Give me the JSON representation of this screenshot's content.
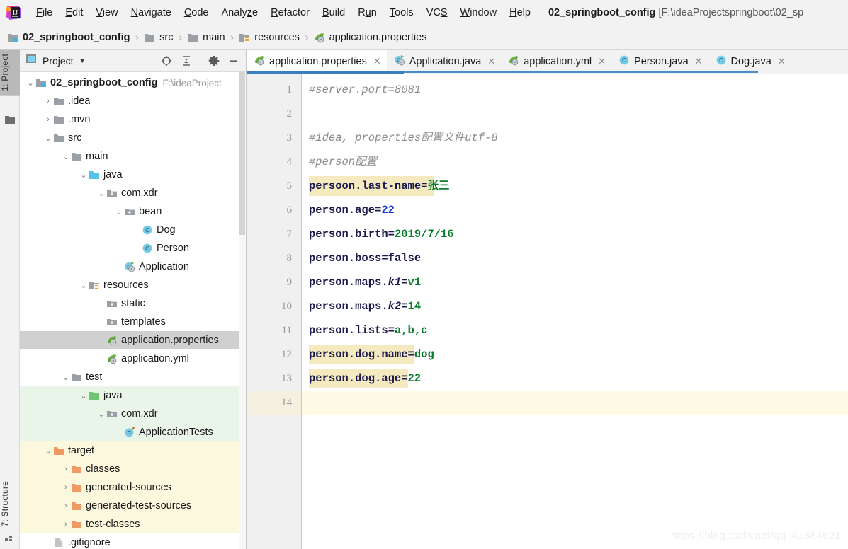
{
  "window": {
    "title_bold": "02_springboot_config",
    "title_path": "[F:\\ideaProjectspringboot\\02_sp"
  },
  "menubar": {
    "logo_icon": "intellij-idea-logo",
    "items": [
      {
        "label": "File",
        "mnemonic": "F"
      },
      {
        "label": "Edit",
        "mnemonic": "E"
      },
      {
        "label": "View",
        "mnemonic": "V"
      },
      {
        "label": "Navigate",
        "mnemonic": "N"
      },
      {
        "label": "Code",
        "mnemonic": "C"
      },
      {
        "label": "Analyze",
        "mnemonic": "z"
      },
      {
        "label": "Refactor",
        "mnemonic": "R"
      },
      {
        "label": "Build",
        "mnemonic": "B"
      },
      {
        "label": "Run",
        "mnemonic": "u"
      },
      {
        "label": "Tools",
        "mnemonic": "T"
      },
      {
        "label": "VCS",
        "mnemonic": "S"
      },
      {
        "label": "Window",
        "mnemonic": "W"
      },
      {
        "label": "Help",
        "mnemonic": "H"
      }
    ]
  },
  "breadcrumb": {
    "items": [
      {
        "label": "02_springboot_config",
        "icon": "module-folder-icon"
      },
      {
        "label": "src",
        "icon": "folder-icon"
      },
      {
        "label": "main",
        "icon": "folder-icon"
      },
      {
        "label": "resources",
        "icon": "resources-folder-icon"
      },
      {
        "label": "application.properties",
        "icon": "spring-properties-icon"
      }
    ],
    "separator": "›"
  },
  "toolstrip": {
    "project_tab": "1: Project",
    "structure_tab": "7: Structure"
  },
  "project_panel": {
    "title": "Project",
    "dropdown_icon": "chevron-down-icon",
    "tools": [
      {
        "name": "locate-icon"
      },
      {
        "name": "collapse-all-icon"
      },
      {
        "name": "gear-icon"
      },
      {
        "name": "minimize-icon"
      }
    ],
    "tree": [
      {
        "label": "02_springboot_config",
        "subpath": "F:\\ideaProject",
        "depth": 0,
        "arrow": "⌄",
        "icon": "module-folder-icon",
        "bold": true,
        "state": "none"
      },
      {
        "label": ".idea",
        "depth": 1,
        "arrow": "›",
        "icon": "folder-icon",
        "state": "none"
      },
      {
        "label": ".mvn",
        "depth": 1,
        "arrow": "›",
        "icon": "folder-icon",
        "state": "none"
      },
      {
        "label": "src",
        "depth": 1,
        "arrow": "⌄",
        "icon": "folder-icon",
        "state": "none"
      },
      {
        "label": "main",
        "depth": 2,
        "arrow": "⌄",
        "icon": "folder-icon",
        "state": "none"
      },
      {
        "label": "java",
        "depth": 3,
        "arrow": "⌄",
        "icon": "source-root-icon",
        "state": "none"
      },
      {
        "label": "com.xdr",
        "depth": 4,
        "arrow": "⌄",
        "icon": "package-icon",
        "state": "none"
      },
      {
        "label": "bean",
        "depth": 5,
        "arrow": "⌄",
        "icon": "package-icon",
        "state": "none"
      },
      {
        "label": "Dog",
        "depth": 6,
        "arrow": "",
        "icon": "java-class-icon",
        "state": "none"
      },
      {
        "label": "Person",
        "depth": 6,
        "arrow": "",
        "icon": "java-class-icon",
        "state": "none"
      },
      {
        "label": "Application",
        "depth": 5,
        "arrow": "",
        "icon": "spring-boot-class-icon",
        "state": "none"
      },
      {
        "label": "resources",
        "depth": 3,
        "arrow": "⌄",
        "icon": "resources-folder-icon",
        "state": "none"
      },
      {
        "label": "static",
        "depth": 4,
        "arrow": "",
        "icon": "package-icon",
        "state": "none"
      },
      {
        "label": "templates",
        "depth": 4,
        "arrow": "",
        "icon": "package-icon",
        "state": "none"
      },
      {
        "label": "application.properties",
        "depth": 4,
        "arrow": "",
        "icon": "spring-properties-icon",
        "state": "selected"
      },
      {
        "label": "application.yml",
        "depth": 4,
        "arrow": "",
        "icon": "spring-properties-icon",
        "state": "none"
      },
      {
        "label": "test",
        "depth": 2,
        "arrow": "⌄",
        "icon": "folder-icon",
        "state": "none"
      },
      {
        "label": "java",
        "depth": 3,
        "arrow": "⌄",
        "icon": "test-source-root-icon",
        "state": "green"
      },
      {
        "label": "com.xdr",
        "depth": 4,
        "arrow": "⌄",
        "icon": "package-icon",
        "state": "green"
      },
      {
        "label": "ApplicationTests",
        "depth": 5,
        "arrow": "",
        "icon": "test-class-icon",
        "state": "green"
      },
      {
        "label": "target",
        "depth": 1,
        "arrow": "⌄",
        "icon": "excluded-folder-icon",
        "state": "yellow"
      },
      {
        "label": "classes",
        "depth": 2,
        "arrow": "›",
        "icon": "excluded-folder-icon",
        "state": "yellow"
      },
      {
        "label": "generated-sources",
        "depth": 2,
        "arrow": "›",
        "icon": "excluded-folder-icon",
        "state": "yellow"
      },
      {
        "label": "generated-test-sources",
        "depth": 2,
        "arrow": "›",
        "icon": "excluded-folder-icon",
        "state": "yellow"
      },
      {
        "label": "test-classes",
        "depth": 2,
        "arrow": "›",
        "icon": "excluded-folder-icon",
        "state": "yellow"
      },
      {
        "label": ".gitignore",
        "depth": 1,
        "arrow": "",
        "icon": "file-icon",
        "state": "none"
      }
    ]
  },
  "editor": {
    "tabs": [
      {
        "label": "application.properties",
        "icon": "spring-properties-icon",
        "active": true
      },
      {
        "label": "Application.java",
        "icon": "spring-boot-class-icon",
        "active": false
      },
      {
        "label": "application.yml",
        "icon": "spring-properties-icon",
        "active": false
      },
      {
        "label": "Person.java",
        "icon": "java-class-icon",
        "active": false
      },
      {
        "label": "Dog.java",
        "icon": "java-class-icon",
        "active": false
      }
    ],
    "close_glyph": "✕",
    "caret_line": 14,
    "lines": [
      {
        "n": 1,
        "tokens": [
          {
            "t": "#server.port=8081",
            "c": "comment"
          }
        ]
      },
      {
        "n": 2,
        "tokens": []
      },
      {
        "n": 3,
        "tokens": [
          {
            "t": "#idea, properties配置文件utf-8",
            "c": "comment"
          }
        ]
      },
      {
        "n": 4,
        "tokens": [
          {
            "t": "#person配置",
            "c": "comment"
          }
        ]
      },
      {
        "n": 5,
        "hl_chars": 19,
        "tokens": [
          {
            "t": "persoon.last-name",
            "c": "key"
          },
          {
            "t": "=",
            "c": "eq"
          },
          {
            "t": "张三",
            "c": "val"
          }
        ]
      },
      {
        "n": 6,
        "tokens": [
          {
            "t": "person.age",
            "c": "key"
          },
          {
            "t": "=",
            "c": "eq"
          },
          {
            "t": "22",
            "c": "num"
          }
        ]
      },
      {
        "n": 7,
        "tokens": [
          {
            "t": "person.birth",
            "c": "key"
          },
          {
            "t": "=",
            "c": "eq"
          },
          {
            "t": "2019/7/16",
            "c": "val"
          }
        ]
      },
      {
        "n": 8,
        "tokens": [
          {
            "t": "person.boss",
            "c": "key"
          },
          {
            "t": "=",
            "c": "eq"
          },
          {
            "t": "false",
            "c": "key"
          }
        ]
      },
      {
        "n": 9,
        "tokens": [
          {
            "t": "person.maps.",
            "c": "key"
          },
          {
            "t": "k1",
            "c": "keyi"
          },
          {
            "t": "=",
            "c": "eq"
          },
          {
            "t": "v1",
            "c": "val"
          }
        ]
      },
      {
        "n": 10,
        "tokens": [
          {
            "t": "person.maps.",
            "c": "key"
          },
          {
            "t": "k2",
            "c": "keyi"
          },
          {
            "t": "=",
            "c": "eq"
          },
          {
            "t": "14",
            "c": "val"
          }
        ]
      },
      {
        "n": 11,
        "tokens": [
          {
            "t": "person.lists",
            "c": "key"
          },
          {
            "t": "=",
            "c": "eq"
          },
          {
            "t": "a,b,c",
            "c": "val"
          }
        ]
      },
      {
        "n": 12,
        "hl_chars": 16,
        "tokens": [
          {
            "t": "person.dog.name",
            "c": "key"
          },
          {
            "t": "=",
            "c": "eq"
          },
          {
            "t": "dog",
            "c": "val"
          }
        ]
      },
      {
        "n": 13,
        "hl_chars": 15,
        "tokens": [
          {
            "t": "person.dog.age",
            "c": "key"
          },
          {
            "t": "=",
            "c": "eq"
          },
          {
            "t": "22",
            "c": "val"
          }
        ]
      },
      {
        "n": 14,
        "tokens": []
      }
    ]
  },
  "watermark": "https://blog.csdn.net/qq_41684621",
  "colors": {
    "accent_blue": "#3a80c1",
    "selection_gray": "#d0d0d0",
    "test_green": "#eaf5ea",
    "excluded_yellow": "#fbf8dd",
    "caret_line": "#fdfbe6",
    "usage_highlight": "#f5e9bf",
    "comment": "#8c8c8c",
    "key": "#1a1a4d",
    "value": "#0a7d2e",
    "number": "#1a3fd6"
  }
}
